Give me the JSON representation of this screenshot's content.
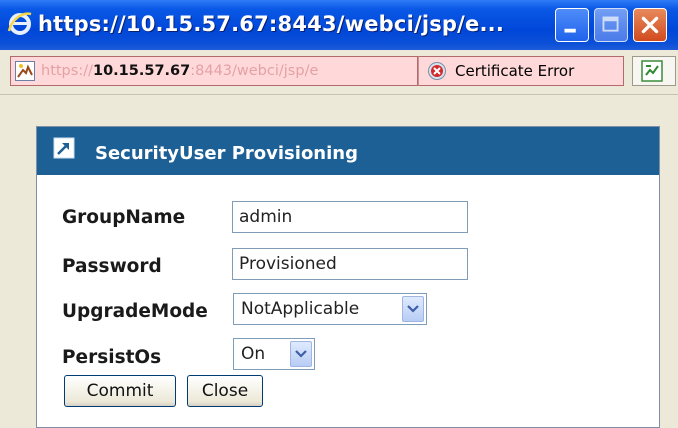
{
  "window": {
    "title": "https://10.15.57.67:8443/webci/jsp/e...",
    "icon": "ie-logo-icon",
    "controls": [
      "minimize-icon",
      "maximize-icon",
      "close-icon"
    ]
  },
  "address_bar": {
    "url_scheme": "https://",
    "url_host": "10.15.57.67",
    "url_rest": ":8443/webci/jsp/e",
    "cert_error_label": "Certificate Error",
    "cert_icon": "shield-error-icon",
    "compat_icon": "compatibility-view-icon"
  },
  "dialog": {
    "title": "SecurityUser  Provisioning",
    "icon": "popout-window-icon",
    "fields": {
      "group_name_label": "GroupName",
      "group_name_value": "admin",
      "password_label": "Password",
      "password_value": "Provisioned",
      "upgrade_mode_label": "UpgradeMode",
      "upgrade_mode_value": "NotApplicable",
      "persist_os_label": "PersistOs",
      "persist_os_value": "On"
    },
    "buttons": {
      "commit": "Commit",
      "close": "Close"
    }
  },
  "colors": {
    "titlebar": "#0047d9",
    "dialog_header": "#1d6096",
    "cert_error_bg": "#ffd9d9"
  }
}
